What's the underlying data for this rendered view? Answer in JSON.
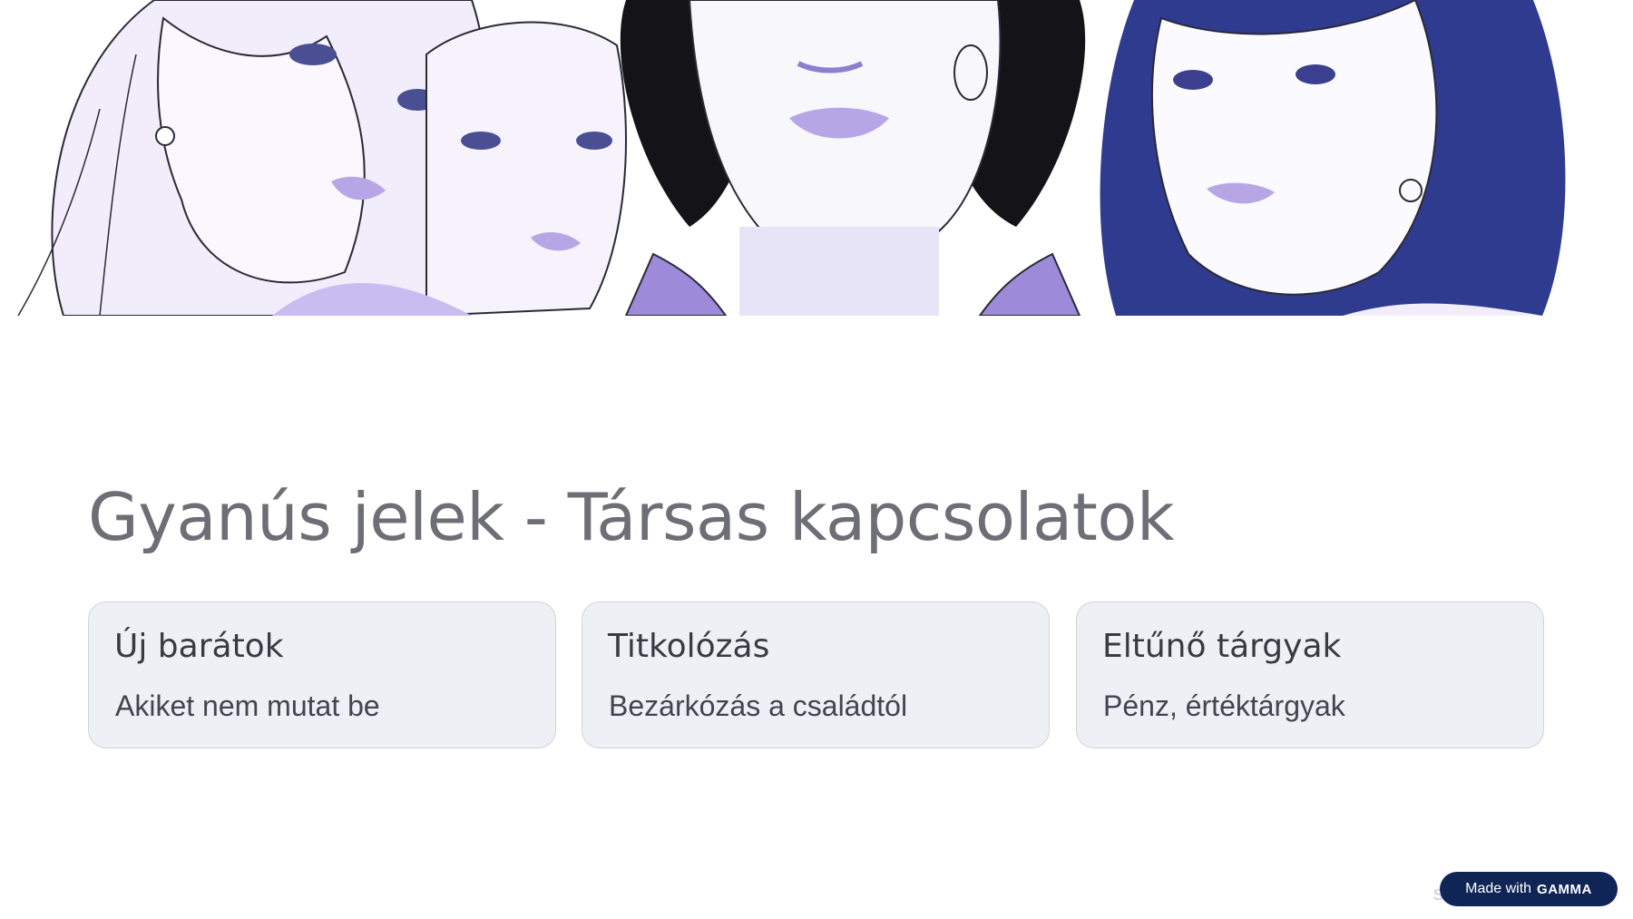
{
  "slide": {
    "title": "Gyanús jelek - Társas kapcsolatok",
    "cards": [
      {
        "title": "Új barátok",
        "description": "Akiket nem mutat be"
      },
      {
        "title": "Titkolózás",
        "description": "Bezárkózás a családtól"
      },
      {
        "title": "Eltűnő tárgyak",
        "description": "Pénz, értéktárgyak"
      }
    ]
  },
  "footer": {
    "faded_text": "s Iskola",
    "badge_prefix": "Made with",
    "badge_brand": "GAMMA"
  },
  "colors": {
    "title": "#6e6e76",
    "card_bg": "#eef0f5",
    "card_border": "#cfd3db",
    "badge_bg": "#0f2556",
    "illustration_lavender": "#b7a6e6",
    "illustration_navy": "#3c3f8f"
  }
}
